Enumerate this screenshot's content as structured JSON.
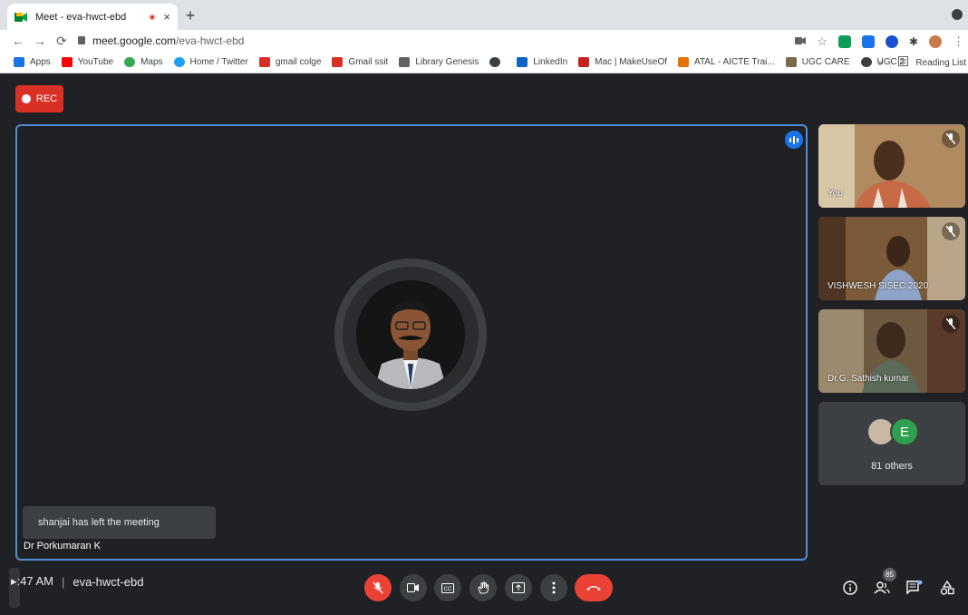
{
  "browser": {
    "tab_title": "Meet - eva-hwct-ebd",
    "new_tab": "+",
    "close": "×",
    "url_host": "meet.google.com",
    "url_path": "/eva-hwct-ebd"
  },
  "bookmarks": {
    "items": [
      {
        "label": "Apps",
        "icon": "apps-grid-icon",
        "color": "#1a73e8"
      },
      {
        "label": "YouTube",
        "icon": "youtube-icon",
        "color": "#ff0000"
      },
      {
        "label": "Maps",
        "icon": "maps-icon",
        "color": "#34a853"
      },
      {
        "label": "Home / Twitter",
        "icon": "twitter-icon",
        "color": "#1da1f2"
      },
      {
        "label": "gmail colge",
        "icon": "gmail-icon",
        "color": "#d93025"
      },
      {
        "label": "Gmail ssit",
        "icon": "gmail-icon",
        "color": "#d93025"
      },
      {
        "label": "Library Genesis",
        "icon": "library-icon",
        "color": "#5f6368"
      },
      {
        "label": "",
        "icon": "globe-icon",
        "color": "#3c4043"
      },
      {
        "label": "LinkedIn",
        "icon": "linkedin-icon",
        "color": "#0a66c2"
      },
      {
        "label": "Mac | MakeUseOf",
        "icon": "makeuseof-icon",
        "color": "#c5221f"
      },
      {
        "label": "ATAL - AICTE Trai...",
        "icon": "aicte-icon",
        "color": "#e37400"
      },
      {
        "label": "UGC CARE",
        "icon": "ugc-icon",
        "color": "#7b6a4a"
      },
      {
        "label": "UGC 2",
        "icon": "globe-icon",
        "color": "#3c4043"
      }
    ],
    "overflow": "»",
    "reading_list": "Reading List"
  },
  "meet": {
    "rec_label": "REC",
    "main_speaker": "Dr Porkumaran K",
    "toast": "shanjai has left the meeting",
    "participants": [
      {
        "name": "You",
        "muted": true
      },
      {
        "name": "VISHWESH SISEC 2020",
        "muted": true
      },
      {
        "name": "Dr.G. Sathish kumar",
        "muted": true
      }
    ],
    "others_avatar_letter": "E",
    "others_label": "81 others",
    "time": "▸:47 AM",
    "separator": "|",
    "meeting_code": "eva-hwct-ebd",
    "people_count": "85",
    "colors": {
      "accent": "#4f8ed6",
      "danger": "#ea4335",
      "rec": "#d93025",
      "speaking": "#1a73e8"
    }
  }
}
